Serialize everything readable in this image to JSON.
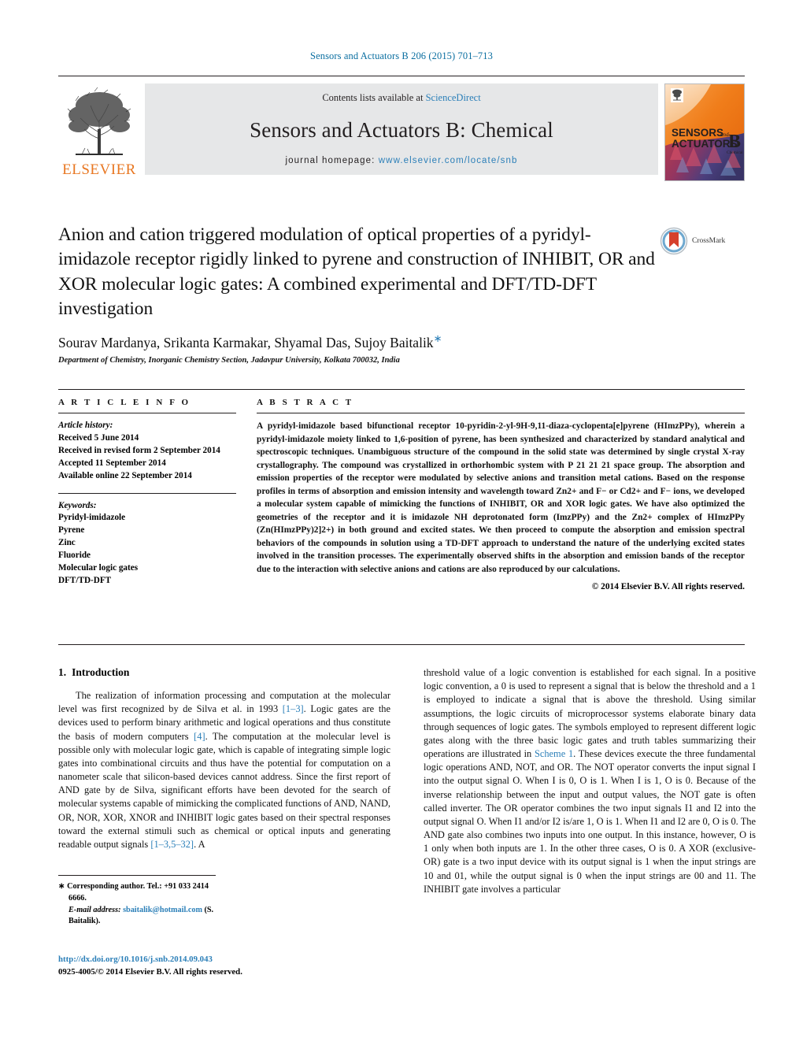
{
  "running_head": "Sensors and Actuators B 206 (2015) 701–713",
  "masthead": {
    "publisher_name": "ELSEVIER",
    "contents_prefix": "Contents lists available at ",
    "contents_link": "ScienceDirect",
    "journal_title": "Sensors and Actuators B: Chemical",
    "homepage_prefix": "journal homepage: ",
    "homepage_url": "www.elsevier.com/locate/snb",
    "cover_line1": "SENSORS",
    "cover_and": "and",
    "cover_line2": "ACTUATORS",
    "cover_b": "B",
    "cover_sub": "Chemical"
  },
  "crossmark": {
    "label": "CrossMark"
  },
  "article": {
    "title": "Anion and cation triggered modulation of optical properties of a pyridyl-imidazole receptor rigidly linked to pyrene and construction of INHIBIT, OR and XOR molecular logic gates: A combined experimental and DFT/TD-DFT investigation",
    "authors": "Sourav Mardanya, Srikanta Karmakar, Shyamal Das, Sujoy Baitalik",
    "author_star": "∗",
    "affiliation": "Department of Chemistry, Inorganic Chemistry Section, Jadavpur University, Kolkata 700032, India"
  },
  "article_info": {
    "heading": "A R T I C L E   I N F O",
    "history_title": "Article history:",
    "history": [
      "Received 5 June 2014",
      "Received in revised form 2 September 2014",
      "Accepted 11 September 2014",
      "Available online 22 September 2014"
    ],
    "keywords_title": "Keywords:",
    "keywords": [
      "Pyridyl-imidazole",
      "Pyrene",
      "Zinc",
      "Fluoride",
      "Molecular logic gates",
      "DFT/TD-DFT"
    ]
  },
  "abstract": {
    "heading": "A B S T R A C T",
    "text": "A pyridyl-imidazole based bifunctional receptor 10-pyridin-2-yl-9H-9,11-diaza-cyclopenta[e]pyrene (HImzPPy), wherein a pyridyl-imidazole moiety linked to 1,6-position of pyrene, has been synthesized and characterized by standard analytical and spectroscopic techniques. Unambiguous structure of the compound in the solid state was determined by single crystal X-ray crystallography. The compound was crystallized in orthorhombic system with P 21 21 21 space group. The absorption and emission properties of the receptor were modulated by selective anions and transition metal cations. Based on the response profiles in terms of absorption and emission intensity and wavelength toward Zn2+ and F− or Cd2+ and F− ions, we developed a molecular system capable of mimicking the functions of INHIBIT, OR and XOR logic gates. We have also optimized the geometries of the receptor and it is imidazole NH deprotonated form (ImzPPy) and the Zn2+ complex of HImzPPy (Zn(HImzPPy)2]2+) in both ground and excited states. We then proceed to compute the absorption and emission spectral behaviors of the compounds in solution using a TD-DFT approach to understand the nature of the underlying excited states involved in the transition processes. The experimentally observed shifts in the absorption and emission bands of the receptor due to the interaction with selective anions and cations are also reproduced by our calculations.",
    "copyright": "© 2014 Elsevier B.V. All rights reserved."
  },
  "introduction": {
    "number": "1.",
    "title": "Introduction",
    "left_paragraph": "The realization of information processing and computation at the molecular level was first recognized by de Silva et al. in 1993 [1–3]. Logic gates are the devices used to perform binary arithmetic and logical operations and thus constitute the basis of modern computers [4]. The computation at the molecular level is possible only with molecular logic gate, which is capable of integrating simple logic gates into combinational circuits and thus have the potential for computation on a nanometer scale that silicon-based devices cannot address. Since the first report of AND gate by de Silva, significant efforts have been devoted for the search of molecular systems capable of mimicking the complicated functions of AND, NAND, OR, NOR, XOR, XNOR and INHIBIT logic gates based on their spectral responses toward the external stimuli such as chemical or optical inputs and generating readable output signals [1–3,5–32]. A",
    "right_paragraph": "threshold value of a logic convention is established for each signal. In a positive logic convention, a 0 is used to represent a signal that is below the threshold and a 1 is employed to indicate a signal that is above the threshold. Using similar assumptions, the logic circuits of microprocessor systems elaborate binary data through sequences of logic gates. The symbols employed to represent different logic gates along with the three basic logic gates and truth tables summarizing their operations are illustrated in Scheme 1. These devices execute the three fundamental logic operations AND, NOT, and OR. The NOT operator converts the input signal I into the output signal O. When I is 0, O is 1. When I is 1, O is 0. Because of the inverse relationship between the input and output values, the NOT gate is often called inverter. The OR operator combines the two input signals I1 and I2 into the output signal O. When I1 and/or I2 is/are 1, O is 1. When I1 and I2 are 0, O is 0. The AND gate also combines two inputs into one output. In this instance, however, O is 1 only when both inputs are 1. In the other three cases, O is 0. A XOR (exclusive-OR) gate is a two input device with its output signal is 1 when the input strings are 10 and 01, while the output signal is 0 when the input strings are 00 and 11. The INHIBIT gate involves a particular",
    "reference_links": [
      "[1–3]",
      "[4]",
      "[1–3,5–32]"
    ],
    "scheme_link": "Scheme 1"
  },
  "footnote": {
    "star": "∗",
    "corresponding": "Corresponding author. Tel.: +91 033 2414 6666.",
    "email_label": "E-mail address:",
    "email": "sbaitalik@hotmail.com",
    "email_owner": "(S. Baitalik)."
  },
  "footer": {
    "doi": "http://dx.doi.org/10.1016/j.snb.2014.09.043",
    "issn_line": "0925-4005/© 2014 Elsevier B.V. All rights reserved."
  },
  "colors": {
    "link_blue": "#2b7fb8",
    "header_blue": "#0a6ea0",
    "elsevier_orange": "#e87722",
    "band_grey": "#e6e7e8"
  }
}
